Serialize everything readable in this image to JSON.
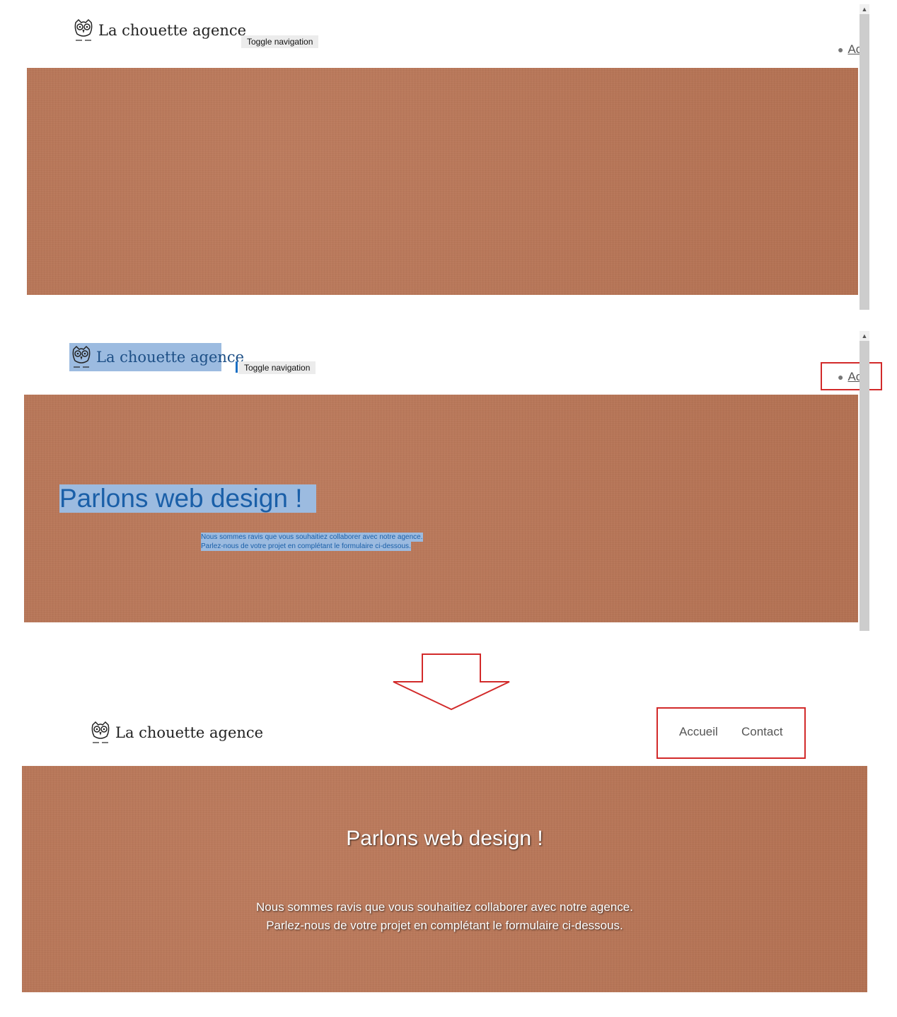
{
  "brand": {
    "name": "La chouette agence",
    "logo_icon": "owl-icon"
  },
  "toggle_label": "Toggle navigation",
  "nav_truncated": "Ac",
  "hero": {
    "title": "Parlons web design !",
    "line1": "Nous sommes ravis que vous souhaitiez collaborer avec notre agence.",
    "line2": "Parlez-nous de votre projet en complétant le formulaire ci-dessous."
  },
  "menu": {
    "items": [
      "Accueil",
      "Contact"
    ]
  },
  "colors": {
    "hero_background": "#b97454",
    "highlight_box": "#d22a2a",
    "selection": "#9cbbe0",
    "selection_text": "#1a5fa8"
  },
  "icons": {
    "arrow": "down-arrow-icon",
    "scroll_up": "scroll-up-icon"
  }
}
